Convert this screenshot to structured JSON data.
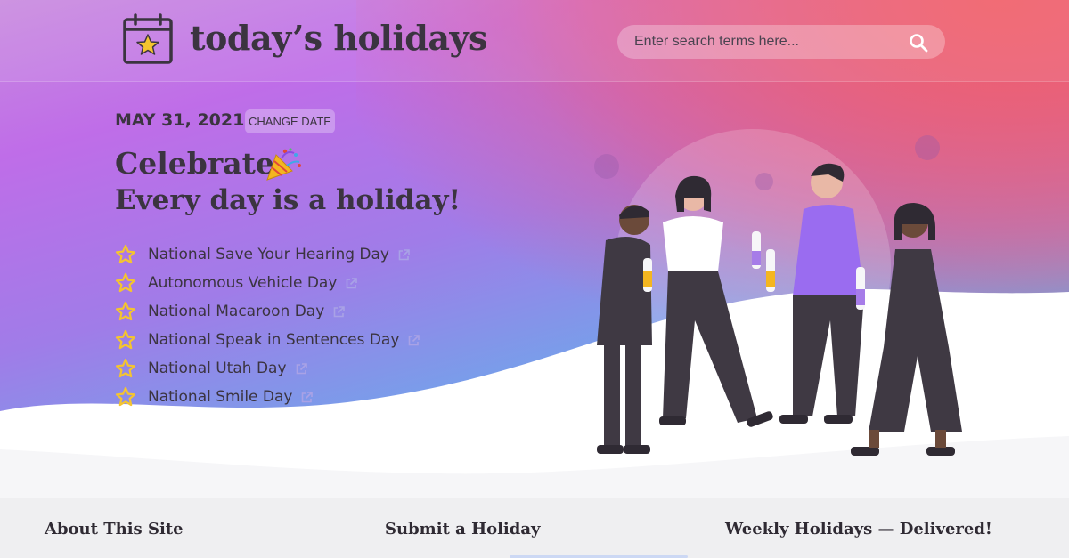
{
  "header": {
    "logo_text": "today’s holidays",
    "search_placeholder": "Enter search terms here..."
  },
  "date": {
    "current": "MAY 31, 2021",
    "change_label": "CHANGE DATE"
  },
  "headline": {
    "line1": "Celebrate",
    "line2": "Every day is a holiday!"
  },
  "holidays": [
    "National Save Your Hearing Day",
    "Autonomous Vehicle Day",
    "National Macaroon Day",
    "National Speak in Sentences Day",
    "National Utah Day",
    "National Smile Day"
  ],
  "footer": {
    "about": "About This Site",
    "submit": "Submit a Holiday",
    "weekly": "Weekly Holidays — Delivered!"
  },
  "icons": {
    "logo": "calendar-star-icon",
    "search": "search-icon",
    "party": "party-popper-icon",
    "list_bullet": "star-icon",
    "external": "external-link-icon"
  },
  "colors": {
    "text_dark": "#3b3440",
    "star_yellow": "#f4c430",
    "hero_pink": "#f0606a",
    "hero_purple": "#bf6de8",
    "hero_cyan": "#23c6e6"
  }
}
